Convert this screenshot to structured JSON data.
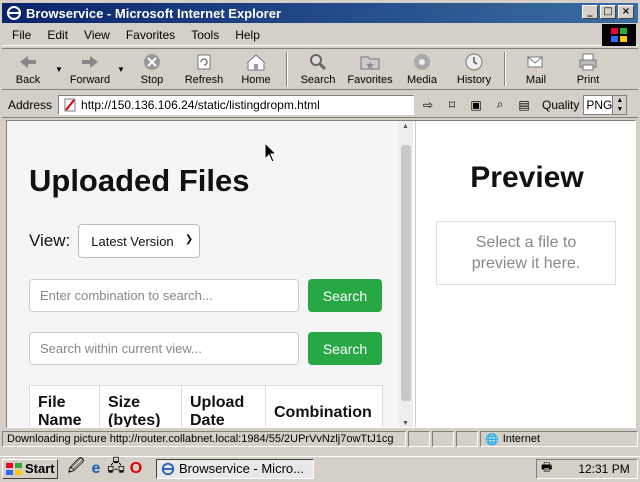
{
  "window": {
    "title": "Browservice - Microsoft Internet Explorer",
    "min": "_",
    "max": "□",
    "close": "×"
  },
  "menu": [
    "File",
    "Edit",
    "View",
    "Favorites",
    "Tools",
    "Help"
  ],
  "toolbar": [
    {
      "label": "Back",
      "icon": "back-arrow-icon"
    },
    {
      "label": "Forward",
      "icon": "forward-arrow-icon"
    },
    {
      "label": "Stop",
      "icon": "stop-icon"
    },
    {
      "label": "Refresh",
      "icon": "refresh-icon"
    },
    {
      "label": "Home",
      "icon": "home-icon"
    },
    {
      "label": "Search",
      "icon": "search-icon"
    },
    {
      "label": "Favorites",
      "icon": "favorites-icon"
    },
    {
      "label": "Media",
      "icon": "media-icon"
    },
    {
      "label": "History",
      "icon": "history-icon"
    },
    {
      "label": "Mail",
      "icon": "mail-icon"
    },
    {
      "label": "Print",
      "icon": "print-icon"
    }
  ],
  "address": {
    "label": "Address",
    "url": "http://150.136.106.24/static/listingdropm.html",
    "quality_label": "Quality",
    "quality_value": "PNG"
  },
  "page": {
    "title": "Uploaded Files",
    "view_label": "View:",
    "view_selected": "Latest Version",
    "search1_placeholder": "Enter combination to search...",
    "search2_placeholder": "Search within current view...",
    "search_button": "Search",
    "table_headers": [
      "File Name",
      "Size (bytes)",
      "Upload Date",
      "Combination"
    ],
    "preview_title": "Preview",
    "preview_text": "Select a file to preview it here."
  },
  "status": {
    "text": "Downloading picture http://router.collabnet.local:1984/55/2UPrVvNzlj7owTtJ1cg",
    "zone": "Internet"
  },
  "taskbar": {
    "start": "Start",
    "task": "Browservice - Micro...",
    "clock": "12:31 PM"
  },
  "colors": {
    "accent": "#28a745",
    "titlebar": "#0a246a"
  }
}
